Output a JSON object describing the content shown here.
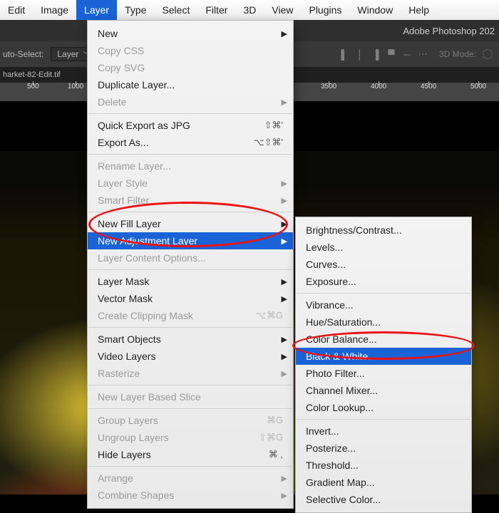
{
  "menubar": {
    "items": [
      "Edit",
      "Image",
      "Layer",
      "Type",
      "Select",
      "Filter",
      "3D",
      "View",
      "Plugins",
      "Window",
      "Help"
    ],
    "active_index": 2
  },
  "app_title": "Adobe Photoshop 202",
  "options_bar": {
    "auto_select_label": "uto-Select:",
    "target_selector": "Layer",
    "align_icons": [
      "align-left",
      "align-center-h",
      "align-right",
      "align-top",
      "align-center-v",
      "more"
    ],
    "mode3d_label": "3D Mode:"
  },
  "document_tab": "harket-82-Edit.tif",
  "ruler_ticks_left": [
    "500",
    "1000"
  ],
  "ruler_ticks_right": [
    "3500",
    "4000",
    "4500",
    "5000"
  ],
  "layer_menu": [
    {
      "label": "New",
      "sub": true
    },
    {
      "label": "Copy CSS",
      "disabled": true
    },
    {
      "label": "Copy SVG",
      "disabled": true
    },
    {
      "label": "Duplicate Layer..."
    },
    {
      "label": "Delete",
      "disabled": true,
      "sub": true
    },
    {
      "sep": true
    },
    {
      "label": "Quick Export as JPG",
      "shortcut": "⇧⌘'"
    },
    {
      "label": "Export As...",
      "shortcut": "⌥⇧⌘'"
    },
    {
      "sep": true
    },
    {
      "label": "Rename Layer...",
      "disabled": true
    },
    {
      "label": "Layer Style",
      "disabled": true,
      "sub": true
    },
    {
      "label": "Smart Filter",
      "disabled": true,
      "sub": true
    },
    {
      "sep": true
    },
    {
      "label": "New Fill Layer",
      "sub": true
    },
    {
      "label": "New Adjustment Layer",
      "sub": true,
      "selected": true
    },
    {
      "label": "Layer Content Options...",
      "disabled": true
    },
    {
      "sep": true
    },
    {
      "label": "Layer Mask",
      "sub": true
    },
    {
      "label": "Vector Mask",
      "sub": true
    },
    {
      "label": "Create Clipping Mask",
      "disabled": true,
      "shortcut": "⌥⌘G"
    },
    {
      "sep": true
    },
    {
      "label": "Smart Objects",
      "sub": true
    },
    {
      "label": "Video Layers",
      "sub": true
    },
    {
      "label": "Rasterize",
      "disabled": true,
      "sub": true
    },
    {
      "sep": true
    },
    {
      "label": "New Layer Based Slice",
      "disabled": true
    },
    {
      "sep": true
    },
    {
      "label": "Group Layers",
      "disabled": true,
      "shortcut": "⌘G"
    },
    {
      "label": "Ungroup Layers",
      "disabled": true,
      "shortcut": "⇧⌘G"
    },
    {
      "label": "Hide Layers",
      "shortcut": "⌘ ,"
    },
    {
      "sep": true
    },
    {
      "label": "Arrange",
      "disabled": true,
      "sub": true
    },
    {
      "label": "Combine Shapes",
      "disabled": true,
      "sub": true
    }
  ],
  "adjustment_submenu": [
    {
      "label": "Brightness/Contrast..."
    },
    {
      "label": "Levels..."
    },
    {
      "label": "Curves..."
    },
    {
      "label": "Exposure..."
    },
    {
      "sep": true
    },
    {
      "label": "Vibrance..."
    },
    {
      "label": "Hue/Saturation..."
    },
    {
      "label": "Color Balance..."
    },
    {
      "label": "Black & White...",
      "selected": true
    },
    {
      "label": "Photo Filter..."
    },
    {
      "label": "Channel Mixer..."
    },
    {
      "label": "Color Lookup..."
    },
    {
      "sep": true
    },
    {
      "label": "Invert..."
    },
    {
      "label": "Posterize..."
    },
    {
      "label": "Threshold..."
    },
    {
      "label": "Gradient Map..."
    },
    {
      "label": "Selective Color..."
    }
  ]
}
